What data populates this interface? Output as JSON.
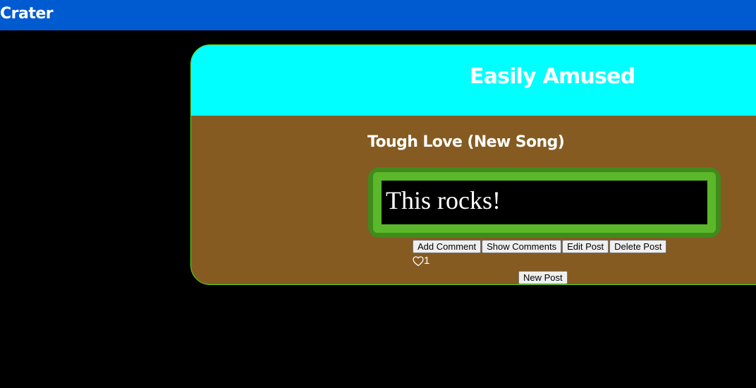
{
  "app": {
    "title": "Crater"
  },
  "board": {
    "title": "Easily Amused"
  },
  "post": {
    "title": "Tough Love (New Song)",
    "body": "This rocks!",
    "actions": {
      "add_comment": "Add Comment",
      "show_comments": "Show Comments",
      "edit_post": "Edit Post",
      "delete_post": "Delete Post"
    },
    "like_icon": "heart-outline-icon",
    "like_count": "1"
  },
  "new_post_label": "New Post",
  "colors": {
    "topbar": "#005bd1",
    "page_background": "#000000",
    "board_header": "#00ffff",
    "board_body": "#855b21",
    "board_border": "#5fdc23",
    "post_frame_dark": "#418a1c",
    "post_frame_light": "#5ab82a",
    "text": "#ffffff"
  }
}
